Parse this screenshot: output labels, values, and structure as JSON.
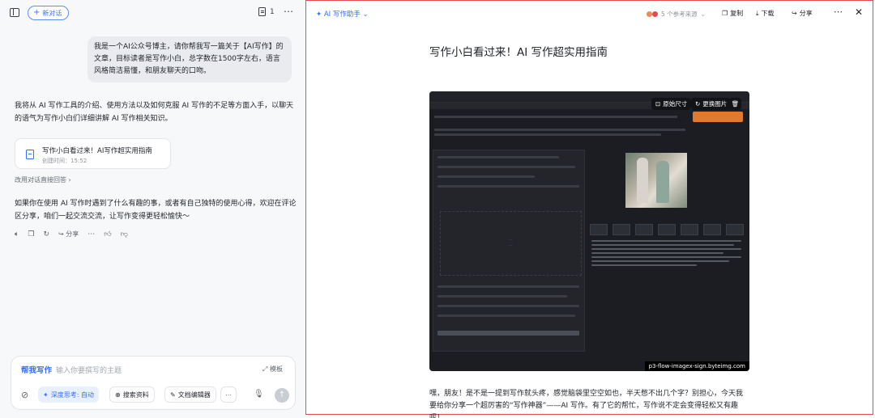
{
  "topbar": {
    "new_chat_label": "新对话",
    "doc_count": "1"
  },
  "chat": {
    "user_message": "我是一个AI公众号博主，请你帮我写一篇关于【AI写作】的文章，目标读者是写作小白，总字数在1500字左右，语言风格简洁易懂，和朋友聊天的口吻。",
    "answer_intro": "我将从 AI 写作工具的介绍、使用方法以及如何克服 AI 写作的不足等方面入手，以聊天的语气为写作小白们详细讲解 AI 写作相关知识。",
    "doc_card": {
      "title": "写作小白看过来！AI写作超实用指南",
      "subtitle": "创建时间：15:52"
    },
    "switch_link": "改用对话直接回答 ›",
    "answer_outro": "如果你在使用 AI 写作时遇到了什么有趣的事，或者有自己独特的使用心得，欢迎在评论区分享，咱们一起交流交流，让写作变得更轻松愉快～",
    "actions": {
      "share_label": "分享"
    }
  },
  "composer": {
    "skill_label": "帮我写作",
    "placeholder": "输入你要撰写的主题",
    "template_label": "模板",
    "deep_think_label": "深度思考: 自动",
    "search_label": "搜索资料",
    "editor_label": "文档编辑器"
  },
  "doc_panel": {
    "assistant_label": "AI 写作助手",
    "sources_label": "5 个参考来源",
    "copy_label": "复制",
    "download_label": "下载",
    "share_label": "分享",
    "title": "写作小白看过来！AI 写作超实用指南",
    "image": {
      "original_size_label": "原始尺寸",
      "replace_label": "更换图片",
      "url_label": "p3-flow-imagex-sign.byteimg.com"
    },
    "paragraph": "嘿，朋友！是不是一提到写作就头疼，感觉脑袋里空空如也，半天憋不出几个字？别担心，今天我要给你分享一个超厉害的“写作神器”——AI 写作。有了它的帮忙，写作说不定会变得轻松又有趣呢！"
  },
  "colors": {
    "accent": "#3370ff",
    "panel_border": "#e5484d",
    "left_bg": "#f7f8fa"
  }
}
